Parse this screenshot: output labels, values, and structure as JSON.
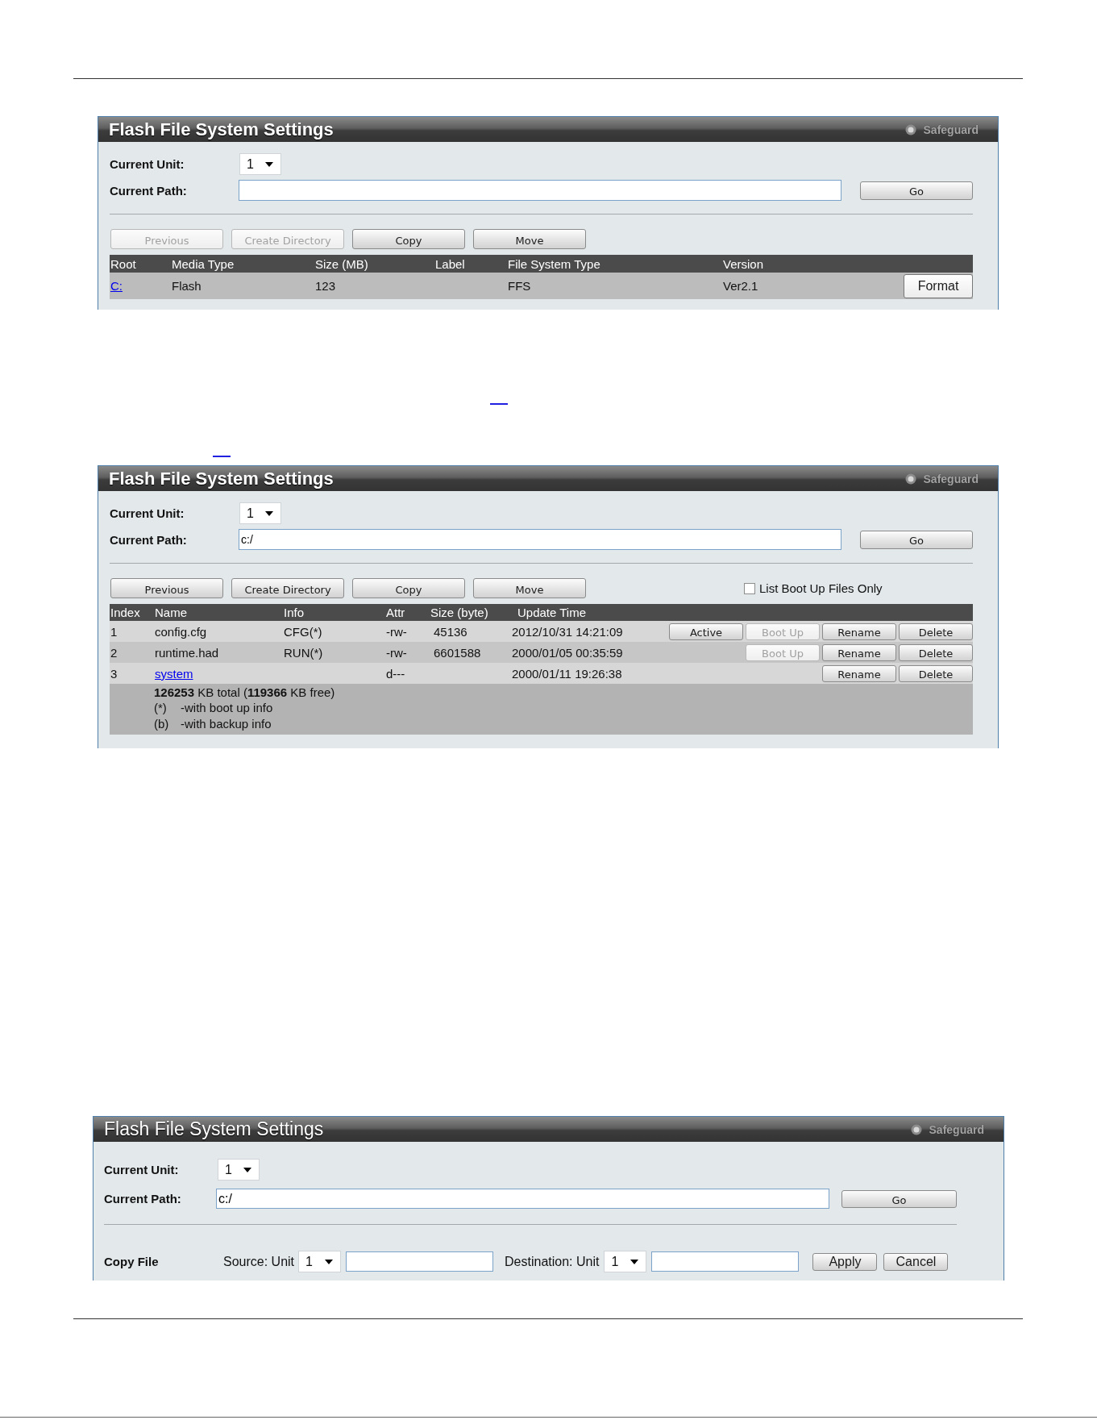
{
  "panels": [
    {
      "kind": "drives",
      "title": "Flash File System Settings",
      "safeguard": "Safeguard",
      "current_unit": {
        "label": "Current Unit:",
        "value": "1"
      },
      "current_path": {
        "label": "Current Path:"
      },
      "go_button": "Go",
      "toolbar": [
        {
          "label": "Previous",
          "disabled": true
        },
        {
          "label": "Create Directory",
          "disabled": true
        },
        {
          "label": "Copy",
          "disabled": false
        },
        {
          "label": "Move",
          "disabled": false
        }
      ],
      "drive_table": {
        "columns": [
          "Root",
          "Media Type",
          "Size (MB)",
          "Label",
          "File System Type",
          "Version"
        ],
        "rows": [
          {
            "root": "C:",
            "media_type": "Flash",
            "size": "123",
            "file_system_type": "FFS",
            "version": "Ver2.1",
            "button": "Format"
          }
        ]
      }
    },
    {
      "kind": "files",
      "title": "Flash File System Settings",
      "safeguard": "Safeguard",
      "current_unit": {
        "label": "Current Unit:",
        "value": "1"
      },
      "current_path": {
        "label": "Current Path:",
        "value": "c:/"
      },
      "go_button": "Go",
      "toolbar": [
        {
          "label": "Previous",
          "disabled": false
        },
        {
          "label": "Create Directory",
          "disabled": false
        },
        {
          "label": "Copy",
          "disabled": false
        },
        {
          "label": "Move",
          "disabled": false
        }
      ],
      "boot_filter": {
        "label": "List Boot Up Files Only",
        "checked": false
      },
      "file_table": {
        "columns": [
          "Index",
          "Name",
          "Info",
          "Attr",
          "Size (byte)",
          "Update Time"
        ],
        "rows": [
          {
            "kind": "file",
            "index": "1",
            "name": "config.cfg",
            "info": "CFG(*)",
            "attr": "-rw-",
            "size": "45136",
            "update_time": "2012/10/31 14:21:09",
            "buttons": [
              {
                "label": "Active",
                "disabled": false
              },
              {
                "label": "Boot Up",
                "disabled": true
              },
              {
                "label": "Rename",
                "disabled": false
              },
              {
                "label": "Delete",
                "disabled": false
              }
            ]
          },
          {
            "kind": "file",
            "index": "2",
            "name": "runtime.had",
            "info": "RUN(*)",
            "attr": "-rw-",
            "size": "6601588",
            "update_time": "2000/01/05 00:35:59",
            "buttons": [
              {
                "label": "Boot Up",
                "disabled": true
              },
              {
                "label": "Rename",
                "disabled": false
              },
              {
                "label": "Delete",
                "disabled": false
              }
            ]
          },
          {
            "kind": "directory",
            "index": "3",
            "name": "system",
            "attr": "d---",
            "update_time": "2000/01/11 19:26:38",
            "buttons": [
              {
                "label": "Rename",
                "disabled": false
              },
              {
                "label": "Delete",
                "disabled": false
              }
            ]
          }
        ],
        "summary": "**126253** KB total (**119366** KB free)",
        "legend": [
          {
            "mark": "(*)",
            "text": "-with boot up info"
          },
          {
            "mark": "(b)",
            "text": "-with backup info"
          }
        ]
      }
    },
    {
      "kind": "copy",
      "title": "Flash File System Settings",
      "safeguard": "Safeguard",
      "current_unit": {
        "label": "Current Unit:",
        "value": "1"
      },
      "current_path": {
        "label": "Current Path:",
        "value": "c:/"
      },
      "go_button": "Go",
      "copy_form": {
        "label": "Copy File",
        "source": {
          "label": "Source: Unit",
          "unit": "1"
        },
        "destination": {
          "label": "Destination: Unit",
          "unit": "1"
        },
        "buttons": [
          "Apply",
          "Cancel"
        ]
      }
    }
  ]
}
